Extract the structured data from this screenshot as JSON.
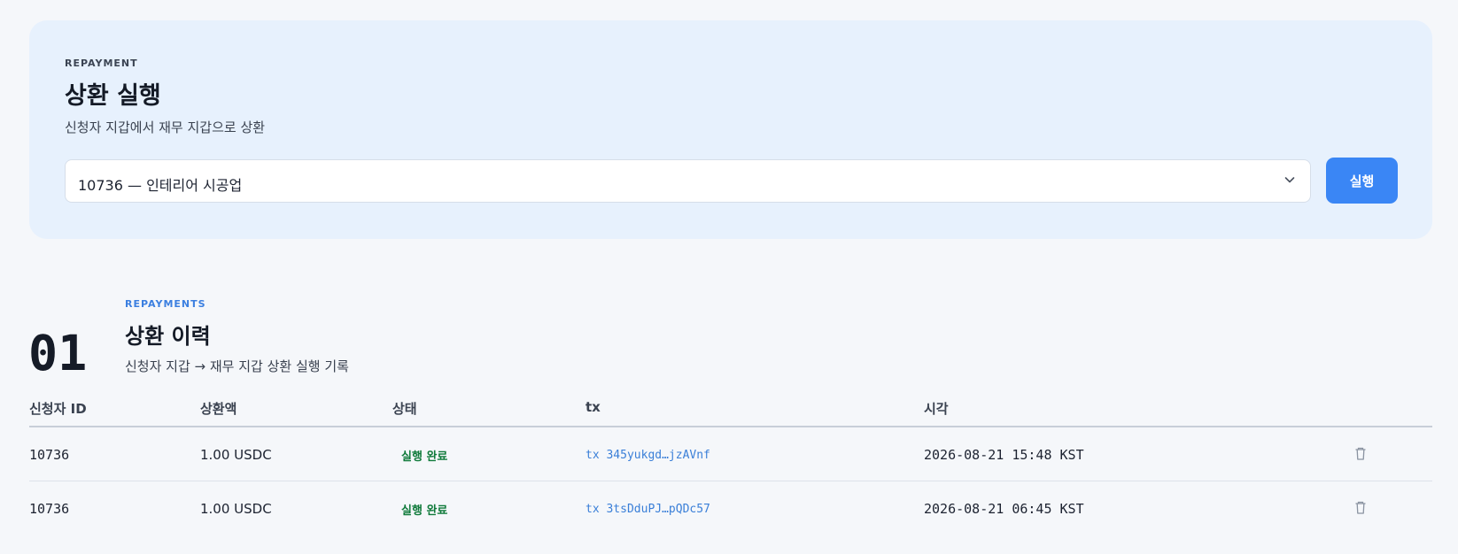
{
  "repayment": {
    "eyebrow": "REPAYMENT",
    "title": "상환 실행",
    "subtitle": "신청자 지갑에서 재무 지갑으로 상환",
    "select_value": "10736 — 인테리어 시공업",
    "run_label": "실행"
  },
  "history": {
    "number": "01",
    "eyebrow": "REPAYMENTS",
    "title": "상환 이력",
    "subtitle": "신청자 지갑 → 재무 지갑 상환 실행 기록",
    "columns": [
      "신청자 ID",
      "상환액",
      "상태",
      "tx",
      "시각"
    ],
    "rows": [
      {
        "applicant_id": "10736",
        "amount": "1.00 USDC",
        "status": "실행 완료",
        "tx": "tx 345yukgd…jzAVnf",
        "time": "2026-08-21 15:48 KST"
      },
      {
        "applicant_id": "10736",
        "amount": "1.00 USDC",
        "status": "실행 완료",
        "tx": "tx 3tsDduPJ…pQDc57",
        "time": "2026-08-21 06:45 KST"
      }
    ]
  },
  "colors": {
    "accent": "#3a86f5",
    "card_bg": "#e7f1fd",
    "status_green": "#0f7a3a",
    "tx_link": "#3a7fd8"
  },
  "icons": {
    "select_chevron": "chevron-down-icon",
    "row_action": "trash-icon"
  }
}
